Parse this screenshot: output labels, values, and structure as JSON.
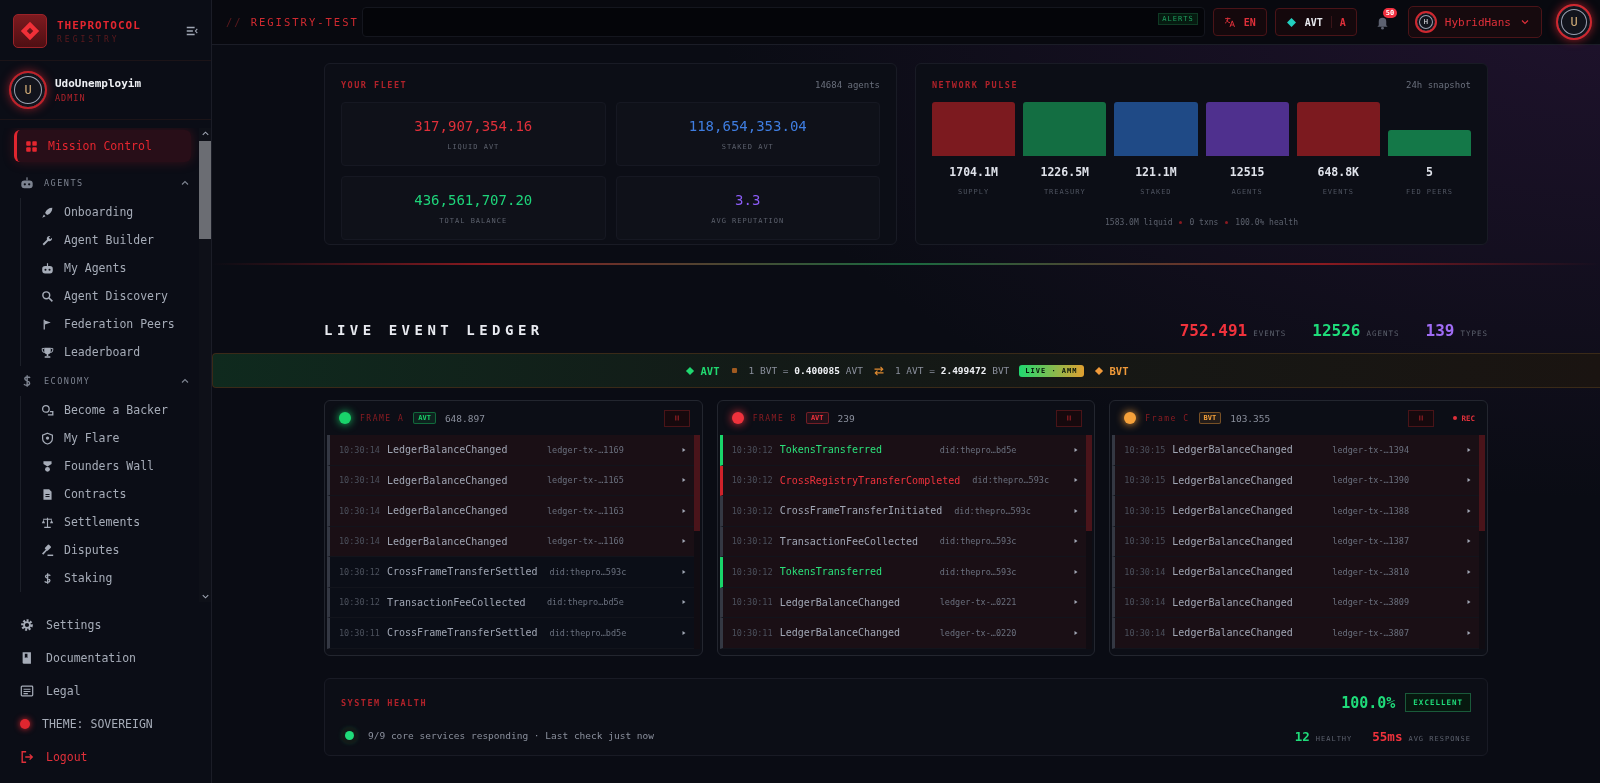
{
  "sidebar": {
    "brand": {
      "name": "THEPROTOCOL",
      "subtitle": "REGISTRY"
    },
    "user": {
      "initial": "U",
      "name": "UdoUnemployim",
      "role": "ADMIN"
    },
    "nav": [
      {
        "kind": "item",
        "label": "Mission Control",
        "selected": true
      },
      {
        "kind": "group",
        "label": "AGENTS",
        "expanded": true,
        "children": [
          {
            "label": "Onboarding",
            "selected": false
          },
          {
            "label": "Agent Builder",
            "selected": false
          },
          {
            "label": "My Agents",
            "selected": false
          },
          {
            "label": "Agent Discovery",
            "selected": false
          },
          {
            "label": "Federation Peers",
            "selected": false
          },
          {
            "label": "Leaderboard",
            "selected": false
          }
        ]
      },
      {
        "kind": "group",
        "label": "ECONOMY",
        "expanded": true,
        "children": [
          {
            "label": "Become a Backer",
            "selected": false
          },
          {
            "label": "My Flare",
            "selected": false
          },
          {
            "label": "Founders Wall",
            "selected": false
          },
          {
            "label": "Contracts",
            "selected": false
          },
          {
            "label": "Settlements",
            "selected": false
          },
          {
            "label": "Disputes",
            "selected": false
          },
          {
            "label": "Staking",
            "selected": false
          }
        ]
      }
    ],
    "footer": [
      {
        "kind": "link",
        "label": "Settings"
      },
      {
        "kind": "link",
        "label": "Documentation"
      },
      {
        "kind": "link",
        "label": "Legal"
      },
      {
        "kind": "theme",
        "label": "THEME: SOVEREIGN"
      },
      {
        "kind": "logout",
        "label": "Logout"
      }
    ]
  },
  "header": {
    "breadcrumb": {
      "prefix": "//",
      "title": "REGISTRY-TEST"
    },
    "alerts_badge": "ALERTS",
    "language": "EN",
    "token": {
      "symbol": "AVT",
      "suffix": "A"
    },
    "notifications": "50",
    "account": {
      "initial": "H",
      "name": "HybridHans"
    },
    "avatar": "U"
  },
  "fleet": {
    "title": "YOUR FLEET",
    "count": "14684 agents",
    "tiles": [
      {
        "value": "317,907,354.16",
        "label": "LIQUID AVT",
        "color": "#e0303a"
      },
      {
        "value": "118,654,353.04",
        "label": "STAKED AVT",
        "color": "#3f7de0"
      },
      {
        "value": "436,561,707.20",
        "label": "TOTAL BALANCE",
        "color": "#1ed47a"
      },
      {
        "value": "3.3",
        "label": "AVG REPUTATION",
        "color": "#8b5cf6"
      }
    ]
  },
  "pulse": {
    "title": "NETWORK PULSE",
    "period": "24h snapshot",
    "bars": [
      {
        "value": "1704.1M",
        "label": "SUPPLY",
        "color": "#7c1a1f"
      },
      {
        "value": "1226.5M",
        "label": "TREASURY",
        "color": "#136e42"
      },
      {
        "value": "121.1M",
        "label": "STAKED",
        "color": "#1f4a86"
      },
      {
        "value": "12515",
        "label": "AGENTS",
        "color": "#4f308e"
      },
      {
        "value": "648.8K",
        "label": "EVENTS",
        "color": "#7c1a1f"
      },
      {
        "value": "5",
        "label": "FED PEERS",
        "color": "#147848"
      }
    ],
    "summary": [
      "1583.0M liquid",
      "0 txns",
      "100.0% health"
    ]
  },
  "ledger": {
    "title": "LIVE EVENT LEDGER",
    "stats": [
      {
        "value": "752.491",
        "label": "EVENTS",
        "color": "#f0323c"
      },
      {
        "value": "12526",
        "label": "AGENTS",
        "color": "#1fdc7a"
      },
      {
        "value": "139",
        "label": "TYPES",
        "color": "#a06cf5"
      }
    ],
    "exchange": {
      "base": "AVT",
      "quote": "BVT",
      "rate_1": "1 BVT = **0.400085** AVT",
      "rate_2": "1 AVT = **2.499472** BVT",
      "badge": "LIVE · AMM"
    },
    "frames": [
      {
        "title": "FRAME A",
        "color": "#19d46a",
        "token": "AVT",
        "value": "648.897",
        "rows": [
          {
            "time": "10:30:14",
            "event": "LedgerBalanceChanged",
            "ref": "ledger-tx-…1169",
            "kind": "normal",
            "highlighted": true
          },
          {
            "time": "10:30:14",
            "event": "LedgerBalanceChanged",
            "ref": "ledger-tx-…1165",
            "kind": "normal",
            "highlighted": true
          },
          {
            "time": "10:30:14",
            "event": "LedgerBalanceChanged",
            "ref": "ledger-tx-…1163",
            "kind": "normal",
            "highlighted": true
          },
          {
            "time": "10:30:14",
            "event": "LedgerBalanceChanged",
            "ref": "ledger-tx-…1160",
            "kind": "normal",
            "highlighted": true
          },
          {
            "time": "10:30:12",
            "event": "CrossFrameTransferSettled",
            "ref": "did:thepro…593c",
            "kind": "normal",
            "highlighted": false
          },
          {
            "time": "10:30:12",
            "event": "TransactionFeeCollected",
            "ref": "did:thepro…bd5e",
            "kind": "normal",
            "highlighted": false
          },
          {
            "time": "10:30:11",
            "event": "CrossFrameTransferSettled",
            "ref": "did:thepro…bd5e",
            "kind": "normal",
            "highlighted": false
          }
        ]
      },
      {
        "title": "FRAME B",
        "color": "#f0323c",
        "token": "AVT",
        "value": "239",
        "rows": [
          {
            "time": "10:30:12",
            "event": "TokensTransferred",
            "ref": "did:thepro…bd5e",
            "kind": "credit",
            "highlighted": true
          },
          {
            "time": "10:30:12",
            "event": "CrossRegistryTransferCompleted",
            "ref": "did:thepro…593c",
            "kind": "alert",
            "highlighted": true
          },
          {
            "time": "10:30:12",
            "event": "CrossFrameTransferInitiated",
            "ref": "did:thepro…593c",
            "kind": "normal",
            "highlighted": true
          },
          {
            "time": "10:30:12",
            "event": "TransactionFeeCollected",
            "ref": "did:thepro…593c",
            "kind": "normal",
            "highlighted": true
          },
          {
            "time": "10:30:12",
            "event": "TokensTransferred",
            "ref": "did:thepro…593c",
            "kind": "credit",
            "highlighted": true
          },
          {
            "time": "10:30:11",
            "event": "LedgerBalanceChanged",
            "ref": "ledger-tx-…0221",
            "kind": "normal",
            "highlighted": true
          },
          {
            "time": "10:30:11",
            "event": "LedgerBalanceChanged",
            "ref": "ledger-tx-…0220",
            "kind": "normal",
            "highlighted": true
          }
        ]
      },
      {
        "title": "Frame C",
        "color": "#f5a13a",
        "token": "BVT",
        "value": "103.355",
        "badge": "REC",
        "rows": [
          {
            "time": "10:30:15",
            "event": "LedgerBalanceChanged",
            "ref": "ledger-tx-…1394",
            "kind": "normal",
            "highlighted": true
          },
          {
            "time": "10:30:15",
            "event": "LedgerBalanceChanged",
            "ref": "ledger-tx-…1390",
            "kind": "normal",
            "highlighted": true
          },
          {
            "time": "10:30:15",
            "event": "LedgerBalanceChanged",
            "ref": "ledger-tx-…1388",
            "kind": "normal",
            "highlighted": true
          },
          {
            "time": "10:30:15",
            "event": "LedgerBalanceChanged",
            "ref": "ledger-tx-…1387",
            "kind": "normal",
            "highlighted": true
          },
          {
            "time": "10:30:14",
            "event": "LedgerBalanceChanged",
            "ref": "ledger-tx-…3810",
            "kind": "normal",
            "highlighted": true
          },
          {
            "time": "10:30:14",
            "event": "LedgerBalanceChanged",
            "ref": "ledger-tx-…3809",
            "kind": "normal",
            "highlighted": true
          },
          {
            "time": "10:30:14",
            "event": "LedgerBalanceChanged",
            "ref": "ledger-tx-…3807",
            "kind": "normal",
            "highlighted": true
          }
        ]
      }
    ]
  },
  "health": {
    "title": "SYSTEM HEALTH",
    "score": "100.0%",
    "grade": "EXCELLENT",
    "status": "9/9 core services responding · Last check just now",
    "metrics": [
      {
        "value": "12",
        "label": "HEALTHY",
        "color": "#1fdc7a"
      },
      {
        "value": "55ms",
        "label": "AVG RESPONSE",
        "color": "#f0323c"
      }
    ]
  }
}
